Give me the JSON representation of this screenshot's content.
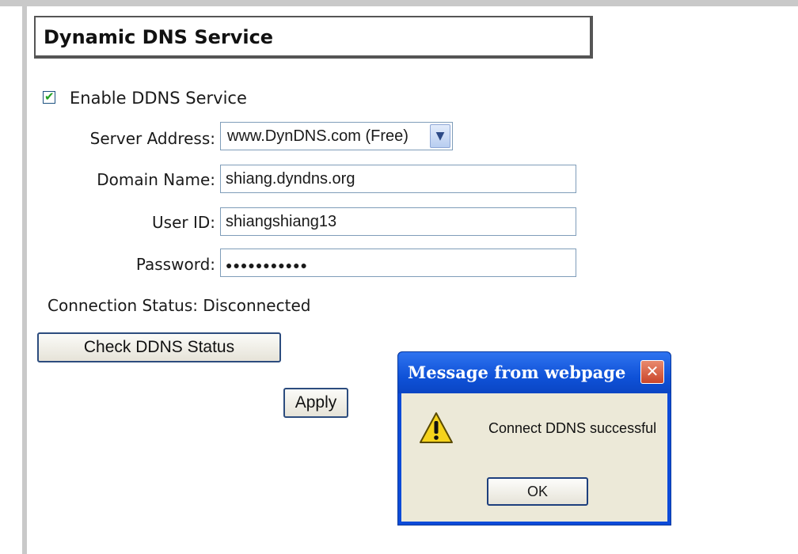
{
  "section": {
    "title": "Dynamic DNS Service"
  },
  "enable": {
    "label": "Enable DDNS Service",
    "checked": true
  },
  "form": {
    "server_address": {
      "label": "Server Address:",
      "value": "www.DynDNS.com (Free)"
    },
    "domain_name": {
      "label": "Domain Name:",
      "value": "shiang.dyndns.org"
    },
    "user_id": {
      "label": "User ID:",
      "value": "shiangshiang13"
    },
    "password": {
      "label": "Password:",
      "masked_value": "●●●●●●●●●●●"
    }
  },
  "status": {
    "text": "Connection Status: Disconnected"
  },
  "buttons": {
    "check_status": "Check DDNS Status",
    "apply": "Apply"
  },
  "dialog": {
    "title": "Message from webpage",
    "message": "Connect DDNS successful",
    "ok_label": "OK",
    "close_glyph": "✕",
    "icon": "warning-icon"
  },
  "colors": {
    "dialog_title_bar": "#0f52d8",
    "dialog_body": "#ece9d8",
    "close_button": "#c9452a",
    "checkbox_tick": "#21a121",
    "button_border": "#2c4c7e"
  }
}
